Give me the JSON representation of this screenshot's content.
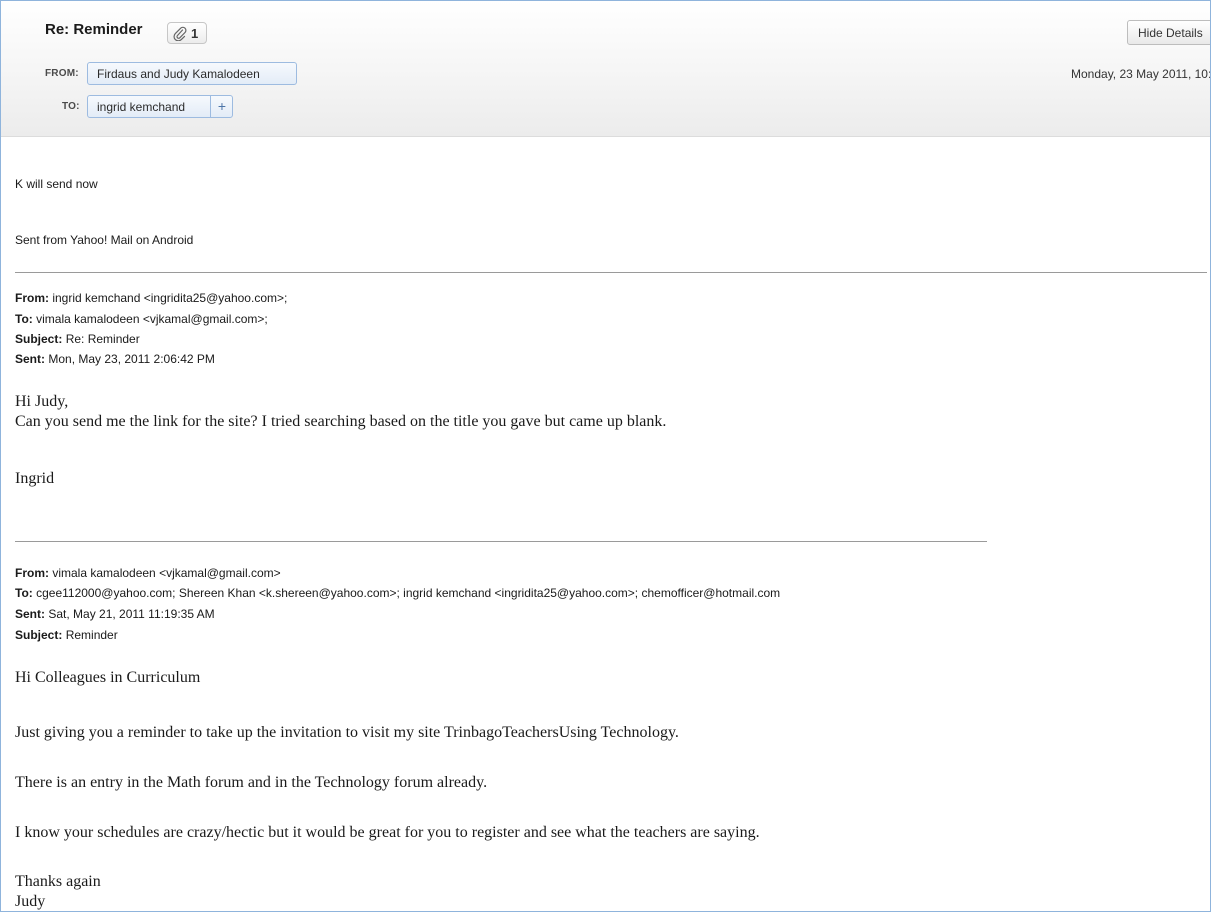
{
  "header": {
    "subject": "Re: Reminder",
    "attachment_count": "1",
    "hide_details_label": "Hide Details",
    "from_label": "FROM:",
    "from_name": "Firdaus and Judy Kamalodeen",
    "to_label": "TO:",
    "to_name": "ingrid kemchand",
    "add_recipient": "+",
    "date": "Monday, 23 May 2011, 10:"
  },
  "reply": {
    "line1": "K will send now",
    "signature": "Sent from Yahoo! Mail on Android"
  },
  "quoted1": {
    "from_label": "From:",
    "from_value": "ingrid kemchand <ingridita25@yahoo.com>;",
    "to_label": "To:",
    "to_value": "vimala kamalodeen <vjkamal@gmail.com>;",
    "subject_label": "Subject:",
    "subject_value": "Re: Reminder",
    "sent_label": "Sent:",
    "sent_value": "Mon, May 23, 2011 2:06:42 PM",
    "greeting": "Hi Judy,",
    "body": "Can you send me the link for the site? I tried searching based on the title you gave but came up blank.",
    "signoff": "Ingrid"
  },
  "quoted2": {
    "from_label": "From:",
    "from_value": "vimala kamalodeen <vjkamal@gmail.com>",
    "to_label": "To:",
    "to_value": "cgee112000@yahoo.com; Shereen Khan <k.shereen@yahoo.com>; ingrid kemchand <ingridita25@yahoo.com>; chemofficer@hotmail.com",
    "sent_label": "Sent:",
    "sent_value": "Sat, May 21, 2011 11:19:35 AM",
    "subject_label": "Subject:",
    "subject_value": "Reminder",
    "greeting": "Hi Colleagues in Curriculum",
    "para1": "Just giving you a reminder to take up the invitation to visit my site TrinbagoTeachersUsing Technology.",
    "para2": "There is an entry in the Math forum and in the Technology forum already.",
    "para3": "I know your schedules are crazy/hectic but it would be great for you to register and see what the teachers are saying.",
    "thanks": "Thanks again",
    "sign": "Judy"
  }
}
